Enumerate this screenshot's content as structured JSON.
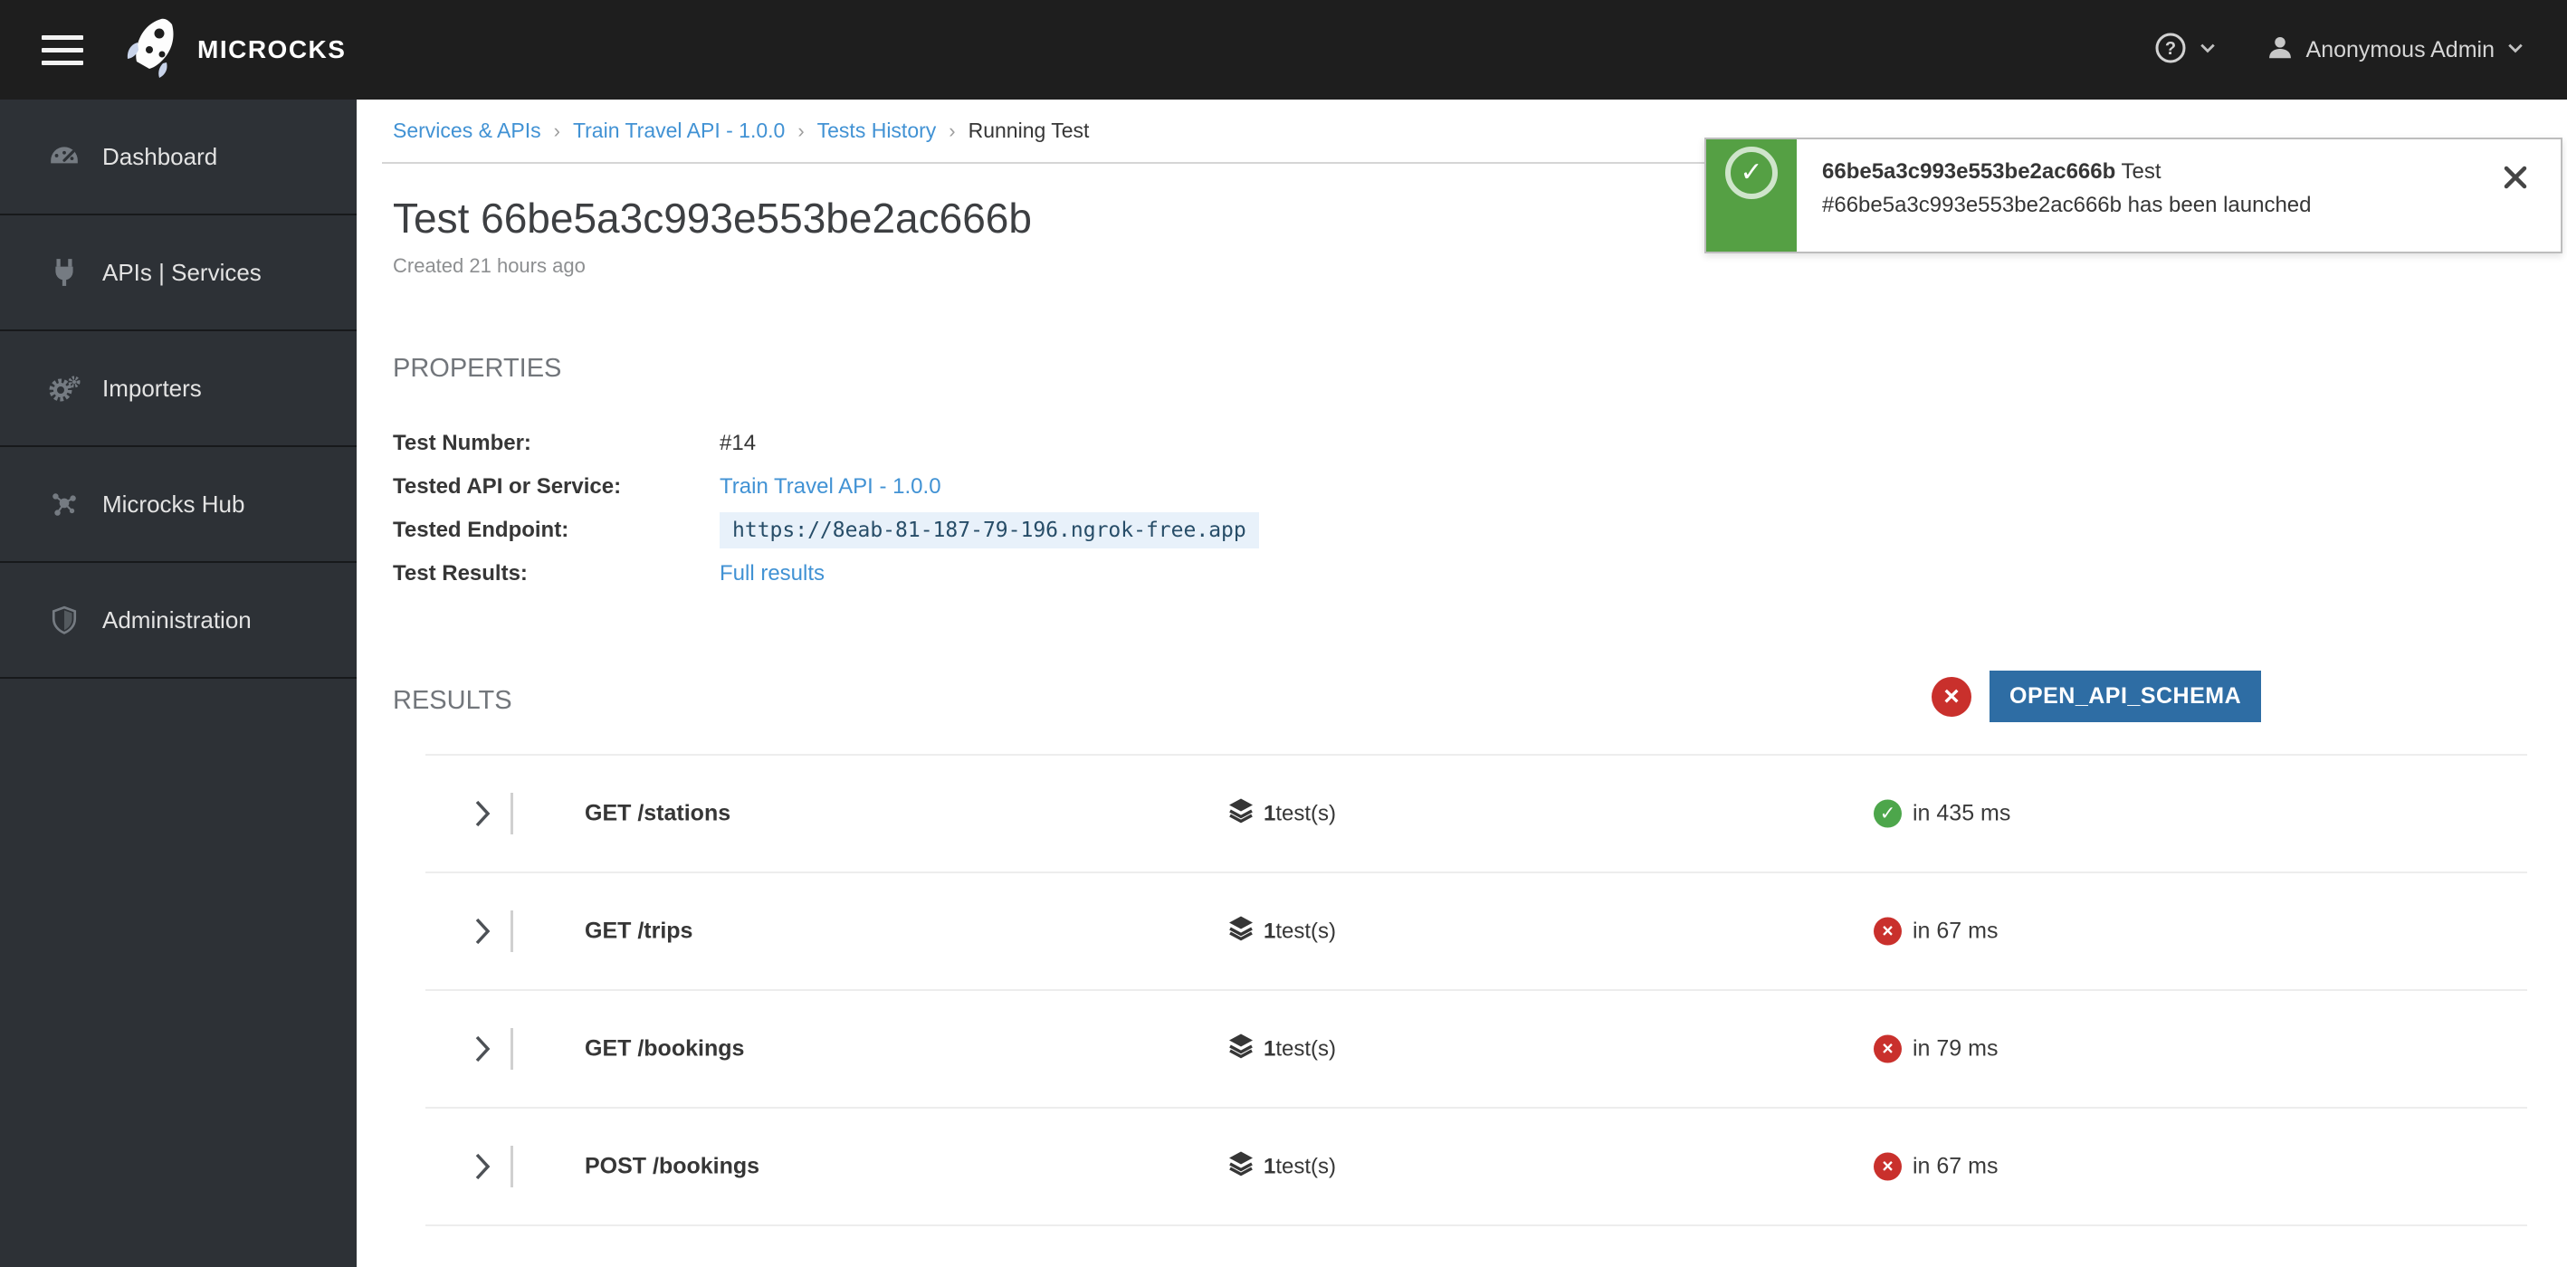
{
  "navbar": {
    "brand": "MICROCKS",
    "hamburger_icon": "hamburger-menu-icon",
    "help_icon": "question-circle-icon",
    "caret_icon": "chevron-down-icon",
    "user_icon": "user-icon",
    "user_name": "Anonymous Admin"
  },
  "sidebar": {
    "items": [
      {
        "label": "Dashboard",
        "icon": "dashboard-gauge-icon"
      },
      {
        "label": "APIs | Services",
        "icon": "plug-icon"
      },
      {
        "label": "Importers",
        "icon": "gears-icon"
      },
      {
        "label": "Microcks Hub",
        "icon": "hub-network-icon"
      },
      {
        "label": "Administration",
        "icon": "shield-icon"
      }
    ]
  },
  "breadcrumb": {
    "items": [
      "Services & APIs",
      "Train Travel API - 1.0.0",
      "Tests History",
      "Running Test"
    ],
    "separator": "›"
  },
  "page": {
    "title": "Test 66be5a3c993e553be2ac666b",
    "created": "Created 21 hours ago"
  },
  "toast": {
    "icon": "success-check-icon",
    "check_glyph": "✓",
    "id": "66be5a3c993e553be2ac666b",
    "title_suffix": " Test",
    "message": "#66be5a3c993e553be2ac666b has been launched",
    "close_icon": "close-icon"
  },
  "properties": {
    "heading": "PROPERTIES",
    "test_number_label": "Test Number:",
    "test_number_value": "#14",
    "tested_api_label": "Tested API or Service:",
    "tested_api_value": "Train Travel API - 1.0.0",
    "tested_endpoint_label": "Tested Endpoint:",
    "tested_endpoint_value": "https://8eab-81-187-79-196.ngrok-free.app",
    "test_results_label": "Test Results:",
    "test_results_value": "Full results",
    "status_icon": "error-circle-icon",
    "status_glyph": "×",
    "status_badge": "OPEN_API_SCHEMA"
  },
  "results": {
    "heading": "RESULTS",
    "rows": [
      {
        "name": "GET /stations",
        "count": "1",
        "count_suffix": " test(s)",
        "time": "in 435 ms",
        "status": "success",
        "status_glyph": "✓"
      },
      {
        "name": "GET /trips",
        "count": "1",
        "count_suffix": " test(s)",
        "time": "in 67 ms",
        "status": "danger",
        "status_glyph": "×"
      },
      {
        "name": "GET /bookings",
        "count": "1",
        "count_suffix": " test(s)",
        "time": "in 79 ms",
        "status": "danger",
        "status_glyph": "×"
      },
      {
        "name": "POST /bookings",
        "count": "1",
        "count_suffix": " test(s)",
        "time": "in 67 ms",
        "status": "danger",
        "status_glyph": "×"
      }
    ]
  },
  "colors": {
    "accent_link": "#4192d4",
    "success": "#4da64b",
    "danger": "#c9302c",
    "badge_bg": "#2e6da4",
    "toast_green": "#55a044",
    "navbar_bg": "#1e1e1e",
    "sidebar_bg": "#2d3136"
  }
}
